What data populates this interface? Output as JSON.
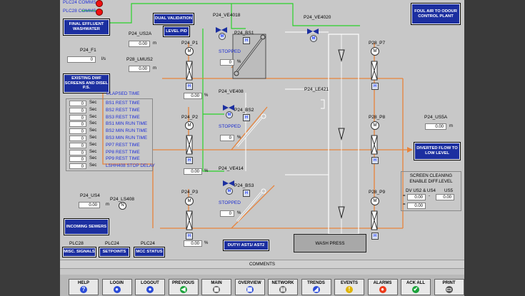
{
  "comms": [
    {
      "label": "PLC24 COMMS",
      "status_color": "#e11d1d"
    },
    {
      "label": "PLC28 COMMS",
      "status_color": "#e11d1d"
    }
  ],
  "buttons": {
    "final_effluent": "FINAL EFFLUENT WASHWATER",
    "dual_validation": "DUAL VALIDATION",
    "level_pid": "LEVEL PID",
    "foul_air": "FOUL AIR TO ODOUR CONTROL PLANT",
    "existing_dwf": "EXISTING DWF SCREENS AND DISEL P.S.",
    "diverted_flow": "DIVERTED FLOW TO LOW LEVEL",
    "incoming_sewers": "INCOMING SEWERS",
    "duty_ast": "DUTY/ AST1/ AST2",
    "misc_signals": "MISC. SIGNALS",
    "setpoints": "SETPOINTS",
    "mcc_status": "MCC STATUS"
  },
  "plc_labels": {
    "misc": "PLC28",
    "setpoints": "PLC24",
    "mcc": "PLC24"
  },
  "tags": {
    "us2a": "P24_US2A",
    "f1": "P24_F1",
    "lmus2": "P28_LMUS2",
    "ve4018": "P24_VE4018",
    "ve4020": "P24_VE4020",
    "bs1": "P24_BS1",
    "bs2": "P24_BS2",
    "bs3": "P24_BS3",
    "p1": "P24_P1",
    "p2": "P24_P2",
    "p3": "P24_P3",
    "p7": "P28_P7",
    "p8": "P28_P8",
    "p9": "P28_P9",
    "ve408": "P24_VE408",
    "ve414": "P24_VE414",
    "le421": "P24_LE421",
    "us5a": "P24_US5A",
    "us4": "P24_US4",
    "ls408": "P24_LS408"
  },
  "values": {
    "us2a": "0.00",
    "f1": "0",
    "lmus2": "0.00",
    "p1": "0.00",
    "p2": "0.00",
    "p3": "0.00",
    "bs1": "0",
    "bs2": "0",
    "bs3": "0",
    "us5a": "0.00",
    "us4": "0.00",
    "diff_us2": "0.00",
    "diff_us5": "0.00",
    "diff_total": "0.00"
  },
  "units": {
    "m": "m",
    "ls": "l/s",
    "pct": "%"
  },
  "symbols": {
    "m": "M",
    "h": "H",
    "n": "N",
    "minus": "-",
    "equals": "="
  },
  "status": {
    "stopped": "STOPPED"
  },
  "elapsed_time": {
    "title": "ELAPSED TIME",
    "unit": "Sec",
    "rows": [
      {
        "value": "0",
        "label": "BS1 REST TIME"
      },
      {
        "value": "0",
        "label": "BS2 REST TIME"
      },
      {
        "value": "0",
        "label": "BS3 REST TIME"
      },
      {
        "value": "0",
        "label": "BS1 MIN RUN TIME"
      },
      {
        "value": "0",
        "label": "BS2 MIN RUN TIME"
      },
      {
        "value": "0",
        "label": "BS3 MIN RUN TIME"
      },
      {
        "value": "0",
        "label": "PP7 REST TIME"
      },
      {
        "value": "0",
        "label": "PP8 REST TIME"
      },
      {
        "value": "0",
        "label": "PP9 REST TIME"
      },
      {
        "value": "0",
        "label": "LSHH408 STOP DELAY"
      }
    ]
  },
  "screen_cleaning": {
    "title": "SCREEN CLEANING ENABLE DIFF.LEVEL",
    "col1": "DV US2 & US4",
    "col2": "US5"
  },
  "wash_press": "WASH PRESS",
  "comments": "COMMENTS",
  "nav": [
    {
      "label": "HELP",
      "icon": "help-icon",
      "glyph": "?",
      "color": "#2a4bd8"
    },
    {
      "label": "LOGIN",
      "icon": "login-icon",
      "glyph": "●",
      "color": "#2a4bd8"
    },
    {
      "label": "LOGOUT",
      "icon": "logout-icon",
      "glyph": "●",
      "color": "#2a4bd8"
    },
    {
      "label": "PREVIOUS",
      "icon": "previous-icon",
      "glyph": "◀",
      "color": "#1aa33a"
    },
    {
      "label": "MAIN",
      "icon": "main-icon",
      "glyph": "▦",
      "color": "#555555"
    },
    {
      "label": "OVERVIEW",
      "icon": "overview-icon",
      "glyph": "▦",
      "color": "#2a4bd8"
    },
    {
      "label": "NETWORK",
      "icon": "network-icon",
      "glyph": "▤",
      "color": "#555555"
    },
    {
      "label": "TRENDS",
      "icon": "trends-icon",
      "glyph": "◢",
      "color": "#2a4bd8"
    },
    {
      "label": "EVENTS",
      "icon": "events-icon",
      "glyph": "!",
      "color": "#e0b400"
    },
    {
      "label": "ALARMS",
      "icon": "alarms-icon",
      "glyph": "●",
      "color": "#ee3a1a"
    },
    {
      "label": "ACK ALL",
      "icon": "ack-all-icon",
      "glyph": "✔",
      "color": "#1aa33a"
    },
    {
      "label": "PRINT",
      "icon": "print-icon",
      "glyph": "▭",
      "color": "#555555"
    }
  ]
}
